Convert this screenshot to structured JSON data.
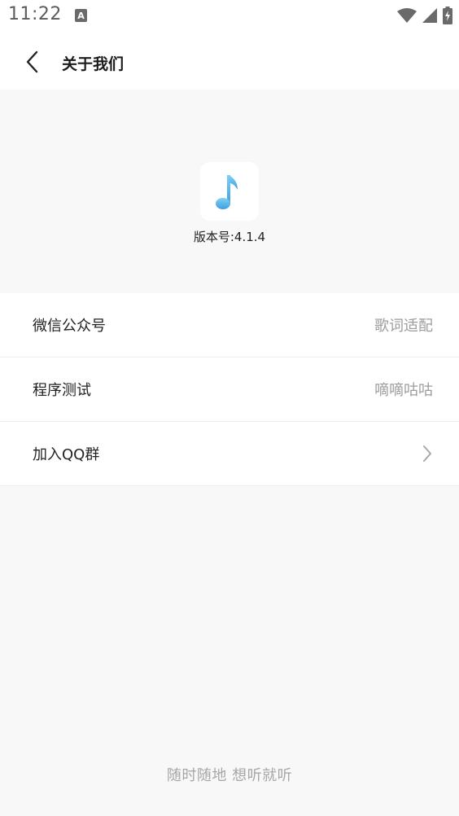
{
  "status_bar": {
    "time": "11:22",
    "notification_icon": "text-a-notification-icon",
    "icons": [
      "wifi-icon",
      "cellular-signal-icon",
      "battery-charging-icon"
    ]
  },
  "header": {
    "title": "关于我们",
    "back_icon": "chevron-left-icon"
  },
  "about": {
    "logo_icon": "music-note-icon",
    "version": "版本号:4.1.4"
  },
  "list": [
    {
      "label": "微信公众号",
      "value": "歌词适配"
    },
    {
      "label": "程序测试",
      "value": "嘀嘀咕咕"
    },
    {
      "label": "加入QQ群",
      "value": "",
      "trailing_icon": "chevron-right-icon"
    }
  ],
  "footer": {
    "slogan": "随时随地 想听就听"
  },
  "colors": {
    "background": "#f8f8f8",
    "surface": "#ffffff",
    "secondary_text": "#9c9c9c",
    "logo_gradient": [
      "#7fd0f4",
      "#3f9fe0"
    ]
  }
}
